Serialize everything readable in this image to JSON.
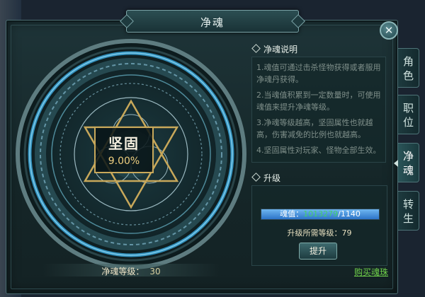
{
  "window": {
    "title": "净魂"
  },
  "stat": {
    "name": "坚固",
    "value": "9.00%"
  },
  "level": {
    "label": "净魂等级：",
    "value": "30"
  },
  "description": {
    "title": "净魂说明",
    "lines": [
      "1.魂值可通过击杀怪物获得或者服用净魂丹获得。",
      "2.当魂值积累到一定数量时，可使用魂值来提升净魂等级。",
      "3.净魂等级越高，坚固属性也就越高，伤害减免的比例也就越高。",
      "4.坚固属性对玩家、怪物全部生效。"
    ]
  },
  "upgrade": {
    "title": "升级",
    "soul_label": "魂值：",
    "soul_current": "1013279",
    "soul_sep": "/",
    "soul_max": "1140",
    "required_level_text": "升级所需等级：79",
    "button_label": "提升",
    "buy_link": "购买魂珠"
  },
  "tabs": [
    {
      "label": "角色",
      "active": false
    },
    {
      "label": "职位",
      "active": false
    },
    {
      "label": "净魂",
      "active": true
    },
    {
      "label": "转生",
      "active": false
    }
  ],
  "colors": {
    "accent_gold": "#c8a85a",
    "soul_green": "#43d06b",
    "link_green": "#6fd04a"
  }
}
